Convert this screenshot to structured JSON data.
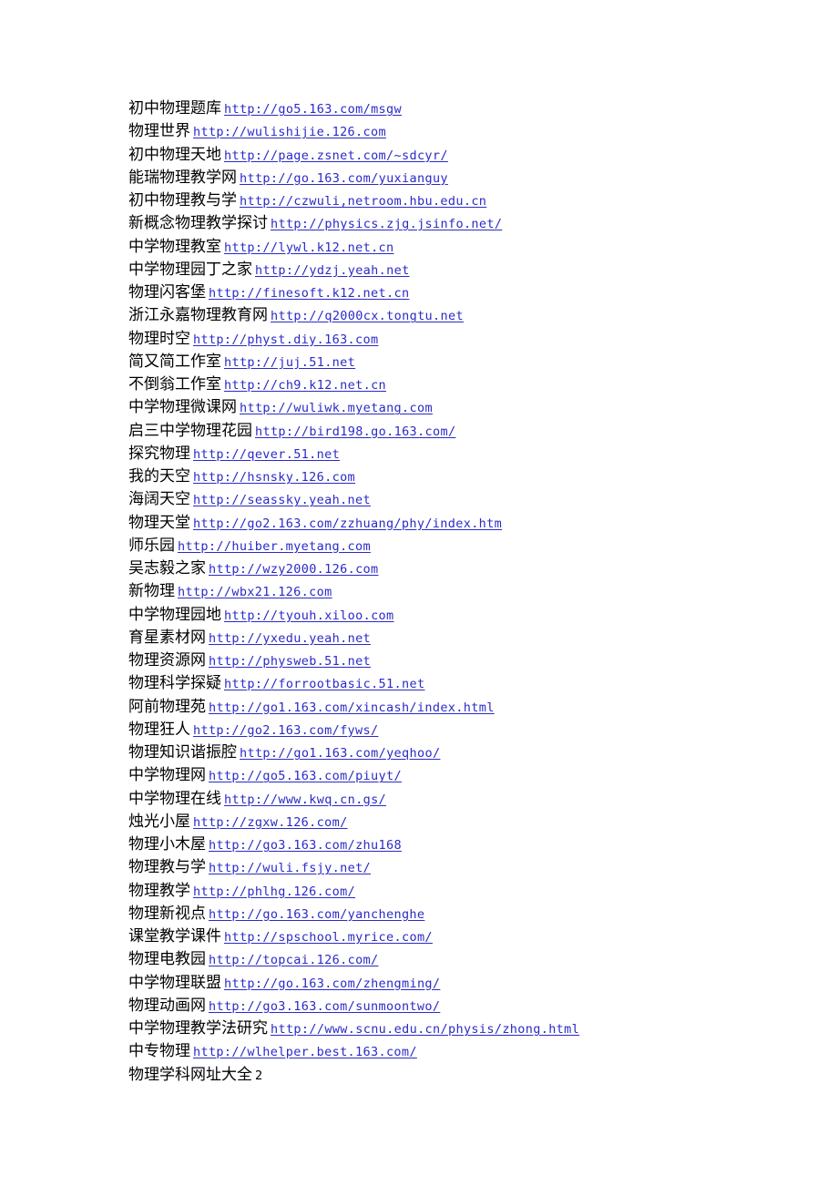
{
  "document": {
    "background_color": "#ffffff",
    "text_color": "#000000",
    "link_color": "#2a2ac8",
    "lines": [
      {
        "label": "初中物理题库",
        "url": "http://go5.163.com/msgw"
      },
      {
        "label": "物理世界",
        "url": "http://wulishijie.126.com"
      },
      {
        "label": "初中物理天地",
        "url": "http://page.zsnet.com/~sdcyr/"
      },
      {
        "label": "能瑞物理教学网",
        "url": "http://go.163.com/yuxianguy"
      },
      {
        "label": "初中物理教与学",
        "url": "http://czwuli,netroom.hbu.edu.cn"
      },
      {
        "label": "新概念物理教学探讨",
        "url": "http://physics.zjg.jsinfo.net/"
      },
      {
        "label": "中学物理教室",
        "url": "http://lywl.k12.net.cn"
      },
      {
        "label": "中学物理园丁之家",
        "url": "http://ydzj.yeah.net"
      },
      {
        "label": "物理闪客堡",
        "url": "http://finesoft.k12.net.cn"
      },
      {
        "label": "浙江永嘉物理教育网",
        "url": "http://q2000cx.tongtu.net"
      },
      {
        "label": "物理时空",
        "url": "http://physt.diy.163.com"
      },
      {
        "label": "简又简工作室",
        "url": "http://juj.51.net"
      },
      {
        "label": "不倒翁工作室",
        "url": "http://ch9.k12.net.cn"
      },
      {
        "label": "中学物理微课网",
        "url": "http://wuliwk.myetang.com"
      },
      {
        "label": "启三中学物理花园",
        "url": "http://bird198.go.163.com/"
      },
      {
        "label": "探究物理",
        "url": "http://qever.51.net"
      },
      {
        "label": "我的天空",
        "url": "http://hsnsky.126.com"
      },
      {
        "label": "海阔天空",
        "url": "http://seassky.yeah.net"
      },
      {
        "label": "物理天堂",
        "url": "http://go2.163.com/zzhuang/phy/index.htm"
      },
      {
        "label": "师乐园",
        "url": "http://huiber.myetang.com"
      },
      {
        "label": "吴志毅之家",
        "url": "http://wzy2000.126.com"
      },
      {
        "label": "新物理",
        "url": "http://wbx21.126.com"
      },
      {
        "label": "中学物理园地",
        "url": "http://tyouh.xiloo.com"
      },
      {
        "label": "育星素材网",
        "url": "http://yxedu.yeah.net"
      },
      {
        "label": "物理资源网",
        "url": "http://physweb.51.net"
      },
      {
        "label": "物理科学探疑",
        "url": "http://forrootbasic.51.net"
      },
      {
        "label": "阿前物理苑",
        "url": "http://go1.163.com/xincash/index.html"
      },
      {
        "label": "物理狂人",
        "url": "http://go2.163.com/fyws/"
      },
      {
        "label": "物理知识谐振腔",
        "url": "http://go1.163.com/yeqhoo/"
      },
      {
        "label": "中学物理网",
        "url": "http://go5.163.com/piuyt/"
      },
      {
        "label": "中学物理在线",
        "url": "http://www.kwq.cn.gs/"
      },
      {
        "label": "烛光小屋",
        "url": "http://zgxw.126.com/"
      },
      {
        "label": "物理小木屋",
        "url": "http://go3.163.com/zhu168"
      },
      {
        "label": "物理教与学",
        "url": "http://wuli.fsjy.net/"
      },
      {
        "label": "物理教学",
        "url": "http://phlhg.126.com/"
      },
      {
        "label": "物理新视点",
        "url": "http://go.163.com/yanchenghe"
      },
      {
        "label": "课堂教学课件",
        "url": "http://spschool.myrice.com/"
      },
      {
        "label": "物理电教园",
        "url": "http://topcai.126.com/"
      },
      {
        "label": "中学物理联盟",
        "url": "http://go.163.com/zhengming/"
      },
      {
        "label": "物理动画网",
        "url": "http://go3.163.com/sunmoontwo/"
      },
      {
        "label": "中学物理教学法研究",
        "url": "http://www.scnu.edu.cn/physis/zhong.html"
      },
      {
        "label": "中专物理",
        "url": "http://wlhelper.best.163.com/"
      }
    ],
    "footer_line": {
      "label": "物理学科网址大全",
      "tail": "2"
    }
  }
}
